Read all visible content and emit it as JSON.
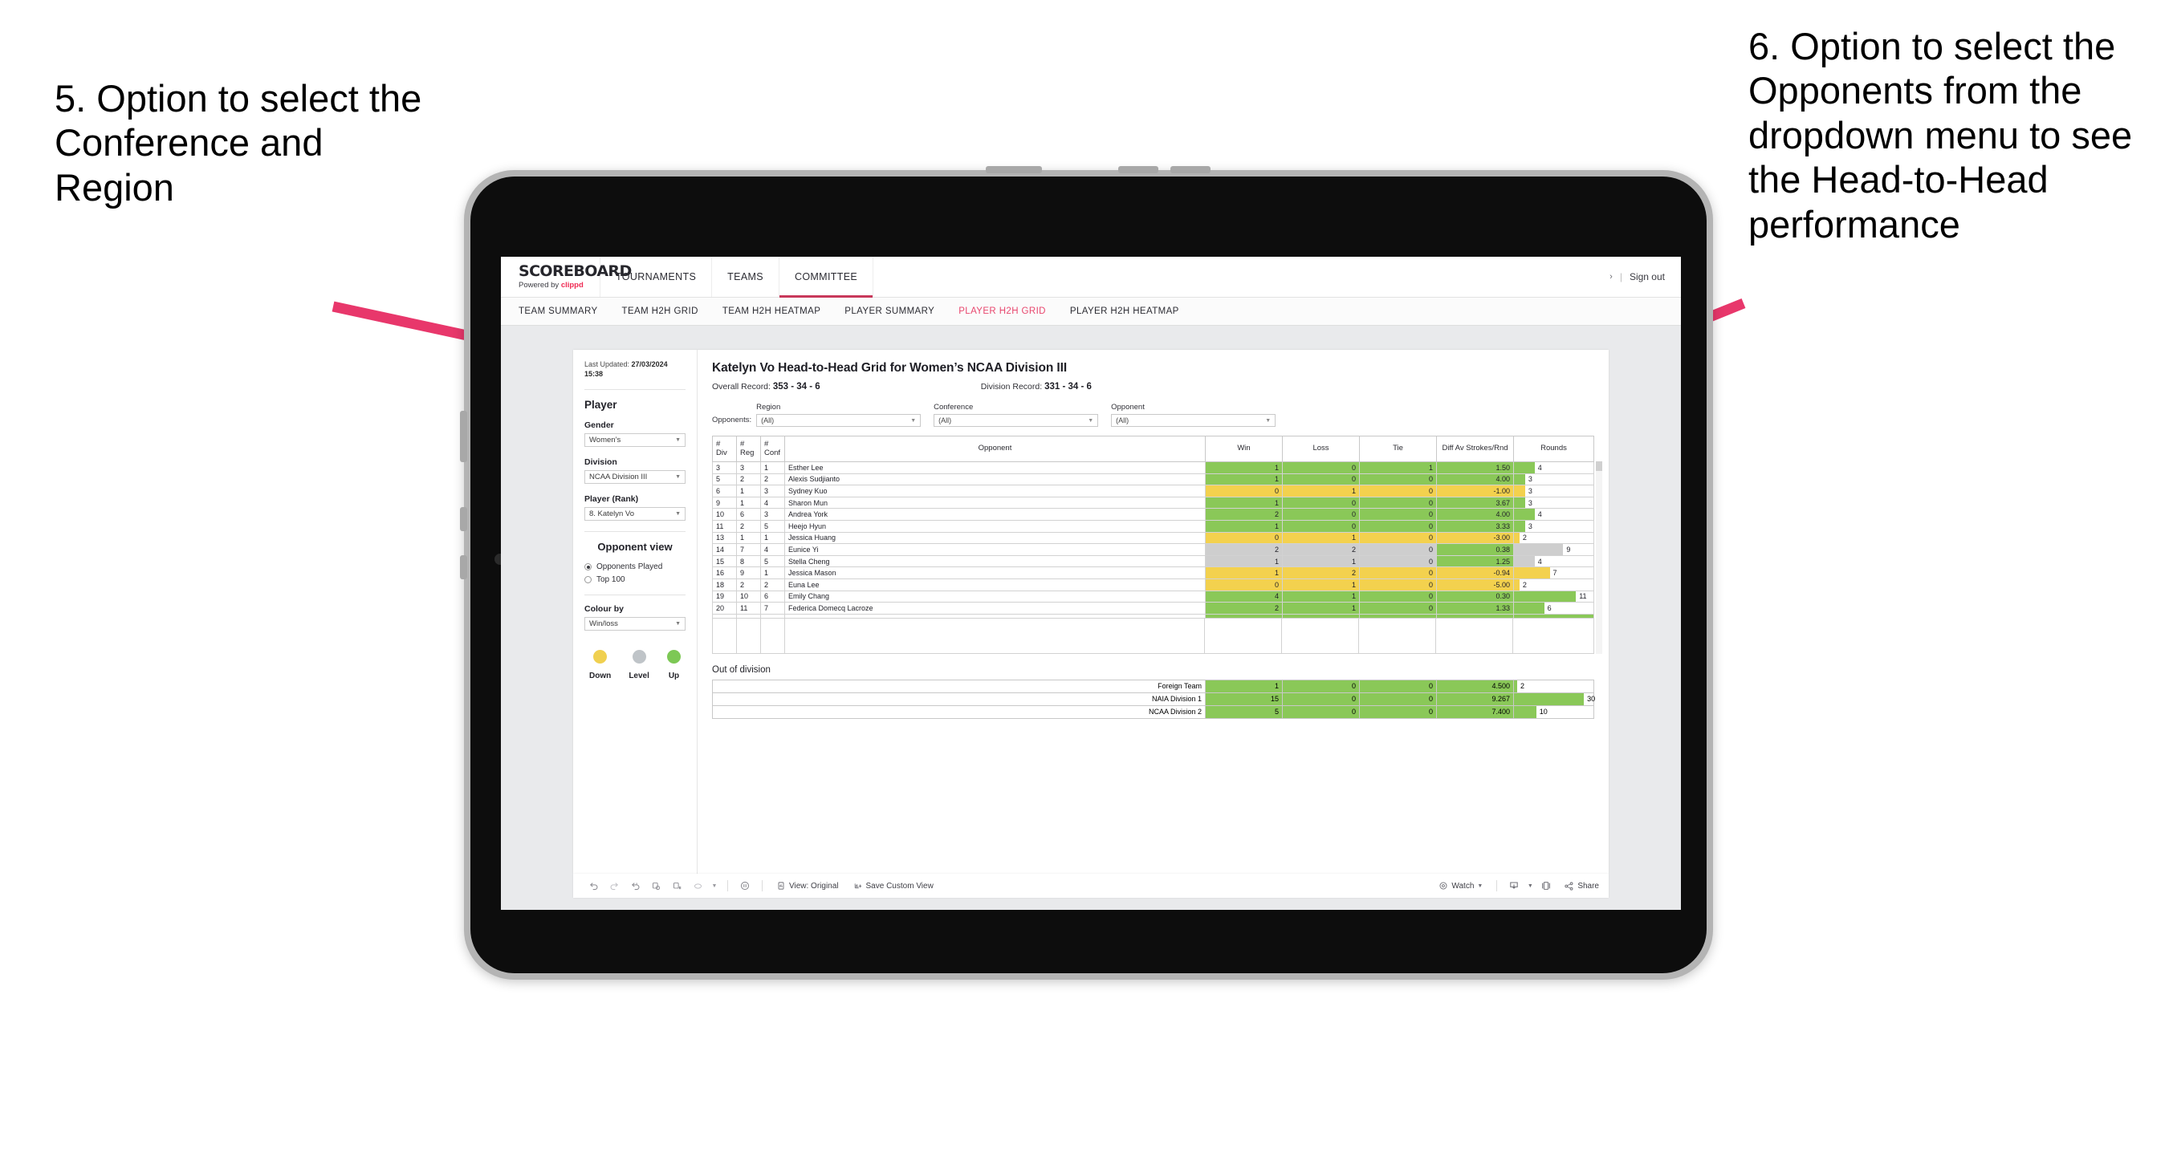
{
  "annotations": {
    "left": "5. Option to select the Conference and Region",
    "right": "6. Option to select the Opponents from the dropdown menu to see the Head-to-Head performance"
  },
  "topnav": {
    "logo_main": "SCOREBOARD",
    "logo_sub_prefix": "Powered by ",
    "logo_sub_brand": "clippd",
    "items": [
      {
        "label": "TOURNAMENTS",
        "active": false
      },
      {
        "label": "TEAMS",
        "active": false
      },
      {
        "label": "COMMITTEE",
        "active": true
      }
    ],
    "chevron": "›",
    "separator": "|",
    "sign_out": "Sign out"
  },
  "subnav": {
    "items": [
      {
        "label": "TEAM SUMMARY",
        "active": false
      },
      {
        "label": "TEAM H2H GRID",
        "active": false
      },
      {
        "label": "TEAM H2H HEATMAP",
        "active": false
      },
      {
        "label": "PLAYER SUMMARY",
        "active": false
      },
      {
        "label": "PLAYER H2H GRID",
        "active": true
      },
      {
        "label": "PLAYER H2H HEATMAP",
        "active": false
      }
    ]
  },
  "sidebar": {
    "last_updated_label": "Last Updated: ",
    "last_updated_date": "27/03/2024",
    "last_updated_time": "15:38",
    "player_heading": "Player",
    "gender_label": "Gender",
    "gender_value": "Women’s",
    "division_label": "Division",
    "division_value": "NCAA Division III",
    "player_rank_label": "Player (Rank)",
    "player_rank_value": "8. Katelyn Vo",
    "opponent_view_heading": "Opponent view",
    "opponent_view_options": [
      {
        "label": "Opponents Played",
        "selected": true
      },
      {
        "label": "Top 100",
        "selected": false
      }
    ],
    "colour_by_label": "Colour by",
    "colour_by_value": "Win/loss",
    "legend": [
      {
        "label": "Down",
        "color": "#f0d050"
      },
      {
        "label": "Level",
        "color": "#bfc4c8"
      },
      {
        "label": "Up",
        "color": "#7dc855"
      }
    ]
  },
  "main": {
    "title": "Katelyn Vo Head-to-Head Grid for Women’s NCAA Division III",
    "overall_record_label": "Overall Record: ",
    "overall_record_value": "353 - 34 - 6",
    "division_record_label": "Division Record: ",
    "division_record_value": "331 -  34 - 6",
    "opponents_label": "Opponents:",
    "filters": [
      {
        "name": "Region",
        "value": "(All)"
      },
      {
        "name": "Conference",
        "value": "(All)"
      },
      {
        "name": "Opponent",
        "value": "(All)"
      }
    ],
    "columns": [
      "# Div",
      "# Reg",
      "# Conf",
      "Opponent",
      "Win",
      "Loss",
      "Tie",
      "Diff Av Strokes/Rnd",
      "Rounds"
    ],
    "rows": [
      {
        "div": "3",
        "reg": "3",
        "conf": "1",
        "opponent": "Esther Lee",
        "win": "1",
        "loss": "0",
        "tie": "1",
        "diff": "1.50",
        "rounds": "4",
        "color": "green",
        "bar_pct": 26
      },
      {
        "div": "5",
        "reg": "2",
        "conf": "2",
        "opponent": "Alexis Sudjianto",
        "win": "1",
        "loss": "0",
        "tie": "0",
        "diff": "4.00",
        "rounds": "3",
        "color": "green",
        "bar_pct": 14
      },
      {
        "div": "6",
        "reg": "1",
        "conf": "3",
        "opponent": "Sydney Kuo",
        "win": "0",
        "loss": "1",
        "tie": "0",
        "diff": "-1.00",
        "rounds": "3",
        "color": "yellow",
        "bar_pct": 14
      },
      {
        "div": "9",
        "reg": "1",
        "conf": "4",
        "opponent": "Sharon Mun",
        "win": "1",
        "loss": "0",
        "tie": "0",
        "diff": "3.67",
        "rounds": "3",
        "color": "green",
        "bar_pct": 14
      },
      {
        "div": "10",
        "reg": "6",
        "conf": "3",
        "opponent": "Andrea York",
        "win": "2",
        "loss": "0",
        "tie": "0",
        "diff": "4.00",
        "rounds": "4",
        "color": "green",
        "bar_pct": 26
      },
      {
        "div": "11",
        "reg": "2",
        "conf": "5",
        "opponent": "Heejo Hyun",
        "win": "1",
        "loss": "0",
        "tie": "0",
        "diff": "3.33",
        "rounds": "3",
        "color": "green",
        "bar_pct": 14
      },
      {
        "div": "13",
        "reg": "1",
        "conf": "1",
        "opponent": "Jessica Huang",
        "win": "0",
        "loss": "1",
        "tie": "0",
        "diff": "-3.00",
        "rounds": "2",
        "color": "yellow",
        "bar_pct": 7
      },
      {
        "div": "14",
        "reg": "7",
        "conf": "4",
        "opponent": "Eunice Yi",
        "win": "2",
        "loss": "2",
        "tie": "0",
        "diff": "0.38",
        "rounds": "9",
        "color": "grey",
        "bar_pct": 62,
        "diff_color": "green"
      },
      {
        "div": "15",
        "reg": "8",
        "conf": "5",
        "opponent": "Stella Cheng",
        "win": "1",
        "loss": "1",
        "tie": "0",
        "diff": "1.25",
        "rounds": "4",
        "color": "grey",
        "bar_pct": 26,
        "diff_color": "green"
      },
      {
        "div": "16",
        "reg": "9",
        "conf": "1",
        "opponent": "Jessica Mason",
        "win": "1",
        "loss": "2",
        "tie": "0",
        "diff": "-0.94",
        "rounds": "7",
        "color": "yellow",
        "bar_pct": 45
      },
      {
        "div": "18",
        "reg": "2",
        "conf": "2",
        "opponent": "Euna Lee",
        "win": "0",
        "loss": "1",
        "tie": "0",
        "diff": "-5.00",
        "rounds": "2",
        "color": "yellow",
        "bar_pct": 7
      },
      {
        "div": "19",
        "reg": "10",
        "conf": "6",
        "opponent": "Emily Chang",
        "win": "4",
        "loss": "1",
        "tie": "0",
        "diff": "0.30",
        "rounds": "11",
        "color": "green",
        "bar_pct": 78
      },
      {
        "div": "20",
        "reg": "11",
        "conf": "7",
        "opponent": "Federica Domecq Lacroze",
        "win": "2",
        "loss": "1",
        "tie": "0",
        "diff": "1.33",
        "rounds": "6",
        "color": "green",
        "bar_pct": 38
      }
    ],
    "out_of_division_title": "Out of division",
    "out_of_division_rows": [
      {
        "label": "Foreign Team",
        "win": "1",
        "loss": "0",
        "tie": "0",
        "diff": "4.500",
        "rounds": "2",
        "color": "green",
        "bar_pct": 4
      },
      {
        "label": "NAIA Division 1",
        "win": "15",
        "loss": "0",
        "tie": "0",
        "diff": "9.267",
        "rounds": "30",
        "color": "green",
        "bar_pct": 88
      },
      {
        "label": "NCAA Division 2",
        "win": "5",
        "loss": "0",
        "tie": "0",
        "diff": "7.400",
        "rounds": "10",
        "color": "green",
        "bar_pct": 28
      }
    ]
  },
  "toolbar": {
    "view_label": "View: Original",
    "save_label": "Save Custom View",
    "watch_label": "Watch",
    "share_label": "Share"
  }
}
